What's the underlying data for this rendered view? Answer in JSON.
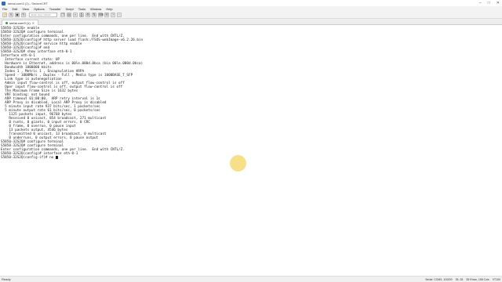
{
  "window": {
    "title": "serial-com3 (1) - SecureCRT",
    "controls": [
      "–",
      "□",
      "✕"
    ]
  },
  "menu": [
    "File",
    "Edit",
    "View",
    "Options",
    "Transfer",
    "Script",
    "Tools",
    "Window",
    "Help"
  ],
  "toolbar": {
    "buttons_left": [
      "connect-icon",
      "quick-connect-icon",
      "connect-tab-icon",
      "reconnect-icon"
    ],
    "host_placeholder": "Enter host <Alt+R>",
    "buttons_right": [
      "copy-icon",
      "paste-icon",
      "find-icon",
      "print-icon",
      "settings-icon",
      "sftp-icon",
      "keymap-icon",
      "options-icon",
      "help-icon",
      "lock-icon"
    ]
  },
  "tab": {
    "label": "serial-com3 (1)",
    "close": "✕"
  },
  "terminal": {
    "lines": [
      "S5850-32S2Q> enable",
      "S5850-32S2Q# configure terminal",
      "Enter configuration commands, one per line.  End with CNTL/Z.",
      "S5850-32S2Q(config)# http server load flash:/FSOS-webImage-v6.2.26.bin",
      "S5850-32S2Q(config)# service http enable",
      "S5850-32S2Q(config)# end",
      "S5850-32S2Q# show interface eth-0-1",
      "Interface eth-0-1",
      "  Interface current state: UP",
      "  Hardware is Ethernet, address is 00le.080d.0bca (bia 00le.080d.0bca)",
      "  Bandwidth 1000000 kbits",
      "  Index 1 , Metric 1 , Encapsulation ARPA",
      "  Speed - 1000Mb/s , Duplex - Full , Media type is 1000BASE_T_SFP",
      "  Link type is autonegotiation",
      "  Admin input flow-control is off, output flow-control is off",
      "  Oper input flow-control is off, output flow-control is off",
      "  The Maximum Frame Size is 1632 bytes",
      "  VRF binding: not bound",
      "  ARP timeout 01:00:00,  ARP retry interval is 1s",
      "  ARP Proxy is disabled, Local ARP Proxy is disabled",
      "  5 minute input rate 937 bits/sec, 1 packets/sec",
      "  5 minute output rate 61 bits/sec, 0 packets/sec",
      "    1125 packets input, 96768 bytes",
      "    Received 0 unicast, 854 broadcast, 271 multicast",
      "    0 runts, 0 giants, 0 input errors, 0 CRC",
      "    0 frame, 0 overrun, 0 pause input",
      "    13 packets output, 4546 bytes",
      "    Transmitted 0 unicast, 13 broadcast, 0 multicast",
      "    0 underruns, 0 output errors, 0 pause output",
      "S5850-32S2Q# configure terminal",
      "S5850-32S2Q# configure terminal",
      "Enter configuration commands, one per line.  End with CNTL/Z.",
      "S5850-32S2Q(config)# interface eth-0-1",
      "S5850-32S2Q(config-if)# no "
    ]
  },
  "status": {
    "left": "Ready",
    "right": [
      "Serial: COM3, 115200",
      "35, 28",
      "35 Rows, 158 Cols",
      "VT100"
    ]
  },
  "colors": {
    "pointer": "#f5dc7a",
    "accent": "#2f6fb5"
  }
}
